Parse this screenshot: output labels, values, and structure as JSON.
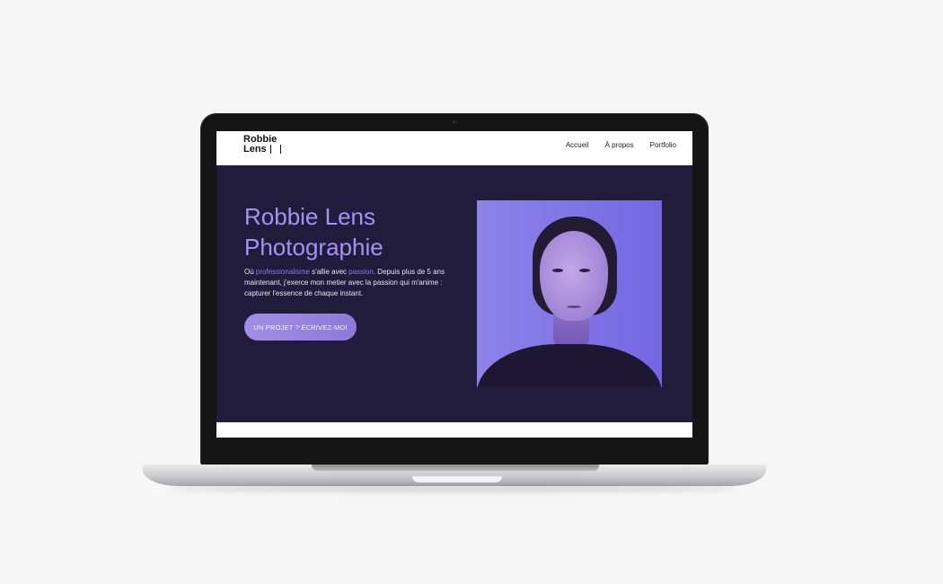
{
  "header": {
    "logo_line1": "Robbie",
    "logo_line2": "Lens",
    "nav": [
      "Accueil",
      "À propos",
      "Portfolio"
    ]
  },
  "hero": {
    "title": "Robbie Lens Photographie",
    "text_part1": "Où ",
    "text_accent1": "professionalisme",
    "text_part2": " s'allie avec ",
    "text_accent2": "passion",
    "text_part3": ". Depuis plus de 5 ans maintenant, j'exerce mon metier avec la passion qui m'anime : capturer l'essence de chaque instant.",
    "cta_label": "UN PROJET ? ÉCRIVEZ-MOI"
  },
  "colors": {
    "hero_bg": "#211b3c",
    "accent": "#a493f2",
    "button": "#9a87e0"
  }
}
